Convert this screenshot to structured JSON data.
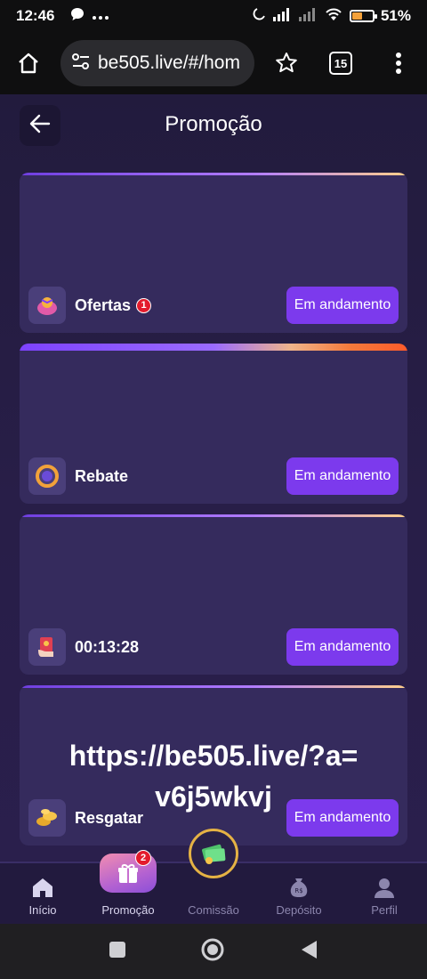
{
  "status_bar": {
    "time": "12:46",
    "battery_percent": "51%",
    "battery_level": 0.51
  },
  "browser": {
    "url": "be505.live/#/hom",
    "tabs_count": "15"
  },
  "header": {
    "title": "Promoção"
  },
  "cards": [
    {
      "label": "Ofertas",
      "badge": "1",
      "button": "Em andamento",
      "icon": "gift-bag-icon"
    },
    {
      "label": "Rebate",
      "button": "Em andamento",
      "icon": "coin-ring-icon"
    },
    {
      "label": "00:13:28",
      "button": "Em andamento",
      "icon": "envelope-hand-icon"
    },
    {
      "label": "Resgatar",
      "button": "Em andamento",
      "icon": "gold-coins-icon"
    }
  ],
  "watermark": {
    "line1": "https://be505.live/?a=",
    "line2": "v6j5wkvj"
  },
  "bottom_nav": {
    "items": [
      {
        "label": "Início",
        "icon": "home-icon"
      },
      {
        "label": "Promoção",
        "icon": "gift-icon",
        "badge": "2"
      },
      {
        "label": "Comissão",
        "icon": "money-stack-icon"
      },
      {
        "label": "Depósito",
        "icon": "money-bag-icon"
      },
      {
        "label": "Perfil",
        "icon": "user-icon"
      }
    ]
  },
  "colors": {
    "accent": "#7c3aed",
    "card_bg": "#352b5d",
    "app_bg": "#281e48",
    "badge_red": "#e31b2c"
  }
}
